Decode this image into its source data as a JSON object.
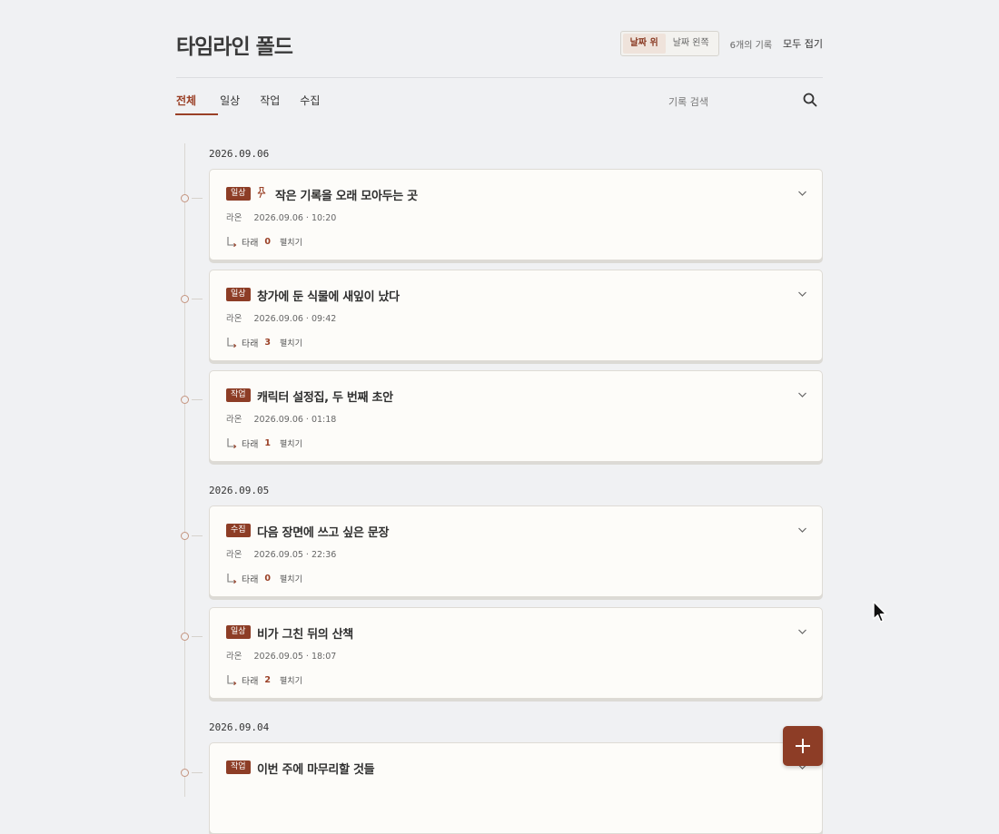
{
  "header": {
    "title": "타임라인 폴드",
    "layout_options": [
      {
        "label": "날짜 위",
        "active": true
      },
      {
        "label": "날짜 왼쪽",
        "active": false
      }
    ],
    "record_count": "6개의 기록",
    "collapse_all": "모두 접기"
  },
  "tabs": [
    {
      "label": "전체",
      "active": true
    },
    {
      "label": "일상",
      "active": false
    },
    {
      "label": "작업",
      "active": false
    },
    {
      "label": "수집",
      "active": false
    }
  ],
  "search": {
    "placeholder": "기록 검색"
  },
  "groups": [
    {
      "date": "2026.09.06",
      "cards": [
        {
          "tag": "일상",
          "pinned": true,
          "title": "작은 기록을 오래 모아두는 곳",
          "author": "라온",
          "time": "2026.09.06 · 10:20",
          "reply_label": "타래",
          "reply_count": "0",
          "expand_label": "펼치기"
        },
        {
          "tag": "일상",
          "pinned": false,
          "title": "창가에 둔 식물에 새잎이 났다",
          "author": "라온",
          "time": "2026.09.06 · 09:42",
          "reply_label": "타래",
          "reply_count": "3",
          "expand_label": "펼치기"
        },
        {
          "tag": "작업",
          "pinned": false,
          "title": "캐릭터 설정집, 두 번째 초안",
          "author": "라온",
          "time": "2026.09.06 · 01:18",
          "reply_label": "타래",
          "reply_count": "1",
          "expand_label": "펼치기"
        }
      ]
    },
    {
      "date": "2026.09.05",
      "cards": [
        {
          "tag": "수집",
          "pinned": false,
          "title": "다음 장면에 쓰고 싶은 문장",
          "author": "라온",
          "time": "2026.09.05 · 22:36",
          "reply_label": "타래",
          "reply_count": "0",
          "expand_label": "펼치기"
        },
        {
          "tag": "일상",
          "pinned": false,
          "title": "비가 그친 뒤의 산책",
          "author": "라온",
          "time": "2026.09.05 · 18:07",
          "reply_label": "타래",
          "reply_count": "2",
          "expand_label": "펼치기"
        }
      ]
    },
    {
      "date": "2026.09.04",
      "cards": [
        {
          "tag": "작업",
          "pinned": false,
          "title": "이번 주에 마무리할 것들",
          "author": "",
          "time": "",
          "reply_label": "",
          "reply_count": "",
          "expand_label": ""
        }
      ]
    }
  ],
  "colors": {
    "accent": "#8d3d26",
    "background": "#f0f1f3",
    "card": "#fdfcf9"
  }
}
